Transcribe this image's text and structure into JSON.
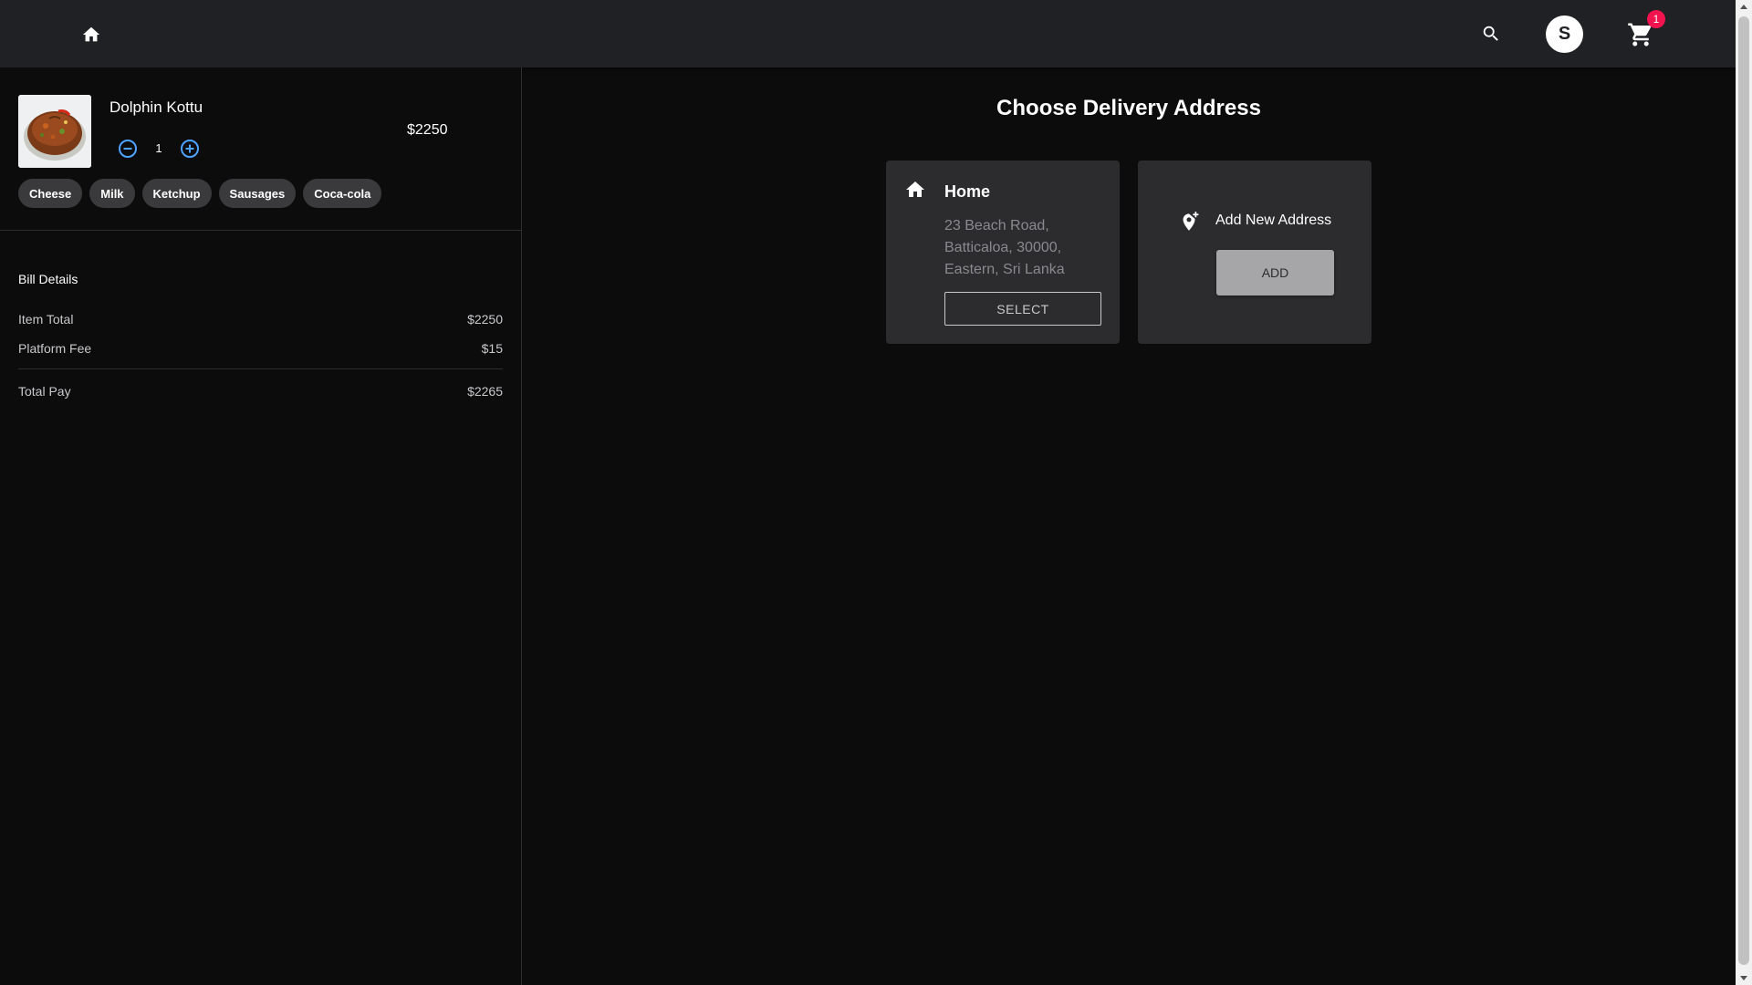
{
  "header": {
    "avatar_initial": "S",
    "cart_count": "1",
    "icons": [
      "home-icon",
      "search-icon",
      "cart-icon"
    ]
  },
  "cart_item": {
    "name": "Dolphin Kottu",
    "quantity": "1",
    "price": "$2250",
    "extras": [
      "Cheese",
      "Milk",
      "Ketchup",
      "Sausages",
      "Coca-cola"
    ]
  },
  "bill": {
    "title": "Bill Details",
    "rows": [
      {
        "label": "Item Total",
        "value": "$2250"
      },
      {
        "label": "Platform Fee",
        "value": "$15"
      }
    ],
    "total": {
      "label": "Total Pay",
      "value": "$2265"
    }
  },
  "main": {
    "title": "Choose Delivery Address",
    "address": {
      "label": "Home",
      "lines": [
        "23 Beach Road,",
        "Batticaloa, 30000,",
        "Eastern, Sri Lanka"
      ],
      "select_label": "SELECT"
    },
    "new_address": {
      "label": "Add New Address",
      "add_label": "ADD"
    }
  },
  "colors": {
    "appbar_bg": "#1f2125",
    "page_bg": "#0c0c0d",
    "card_bg": "#2c2c2e",
    "badge": "#f0134d",
    "qty_accent": "#4da3ff"
  }
}
